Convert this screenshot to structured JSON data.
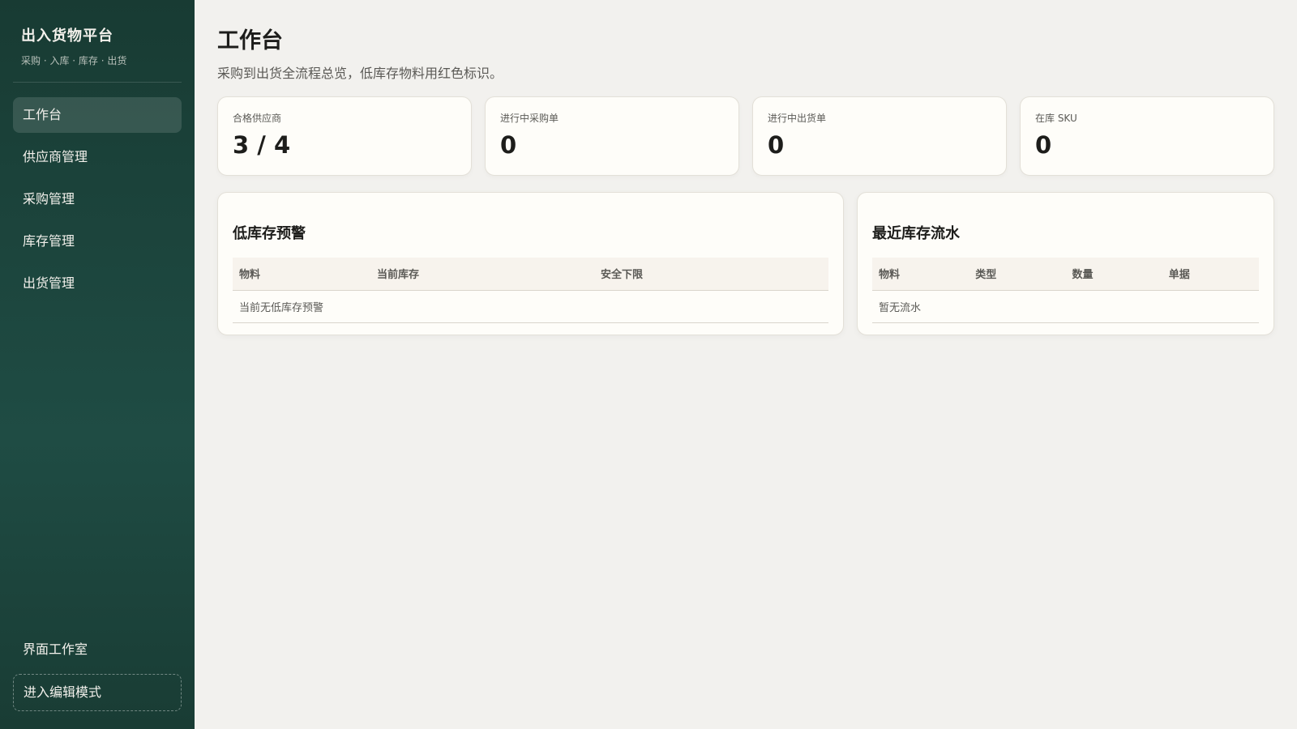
{
  "sidebar": {
    "brand_title": "出入货物平台",
    "brand_subtitle": "采购 · 入库 · 库存 · 出货",
    "items": [
      {
        "label": "工作台"
      },
      {
        "label": "供应商管理"
      },
      {
        "label": "采购管理"
      },
      {
        "label": "库存管理"
      },
      {
        "label": "出货管理"
      }
    ],
    "studio_label": "界面工作室",
    "edit_button": "进入编辑模式"
  },
  "header": {
    "title": "工作台",
    "description": "采购到出货全流程总览，低库存物料用红色标识。"
  },
  "stats": [
    {
      "label": "合格供应商",
      "value": "3 / 4"
    },
    {
      "label": "进行中采购单",
      "value": "0"
    },
    {
      "label": "进行中出货单",
      "value": "0"
    },
    {
      "label": "在库 SKU",
      "value": "0"
    }
  ],
  "low_stock": {
    "title": "低库存预警",
    "columns": [
      "物料",
      "当前库存",
      "安全下限"
    ],
    "empty_text": "当前无低库存预警"
  },
  "recent_flow": {
    "title": "最近库存流水",
    "columns": [
      "物料",
      "类型",
      "数量",
      "单据"
    ],
    "empty_text": "暂无流水"
  },
  "colors": {
    "sidebar_bg": "#1d4740",
    "page_bg": "#f2f1ee",
    "card_bg": "#fefdf9"
  }
}
